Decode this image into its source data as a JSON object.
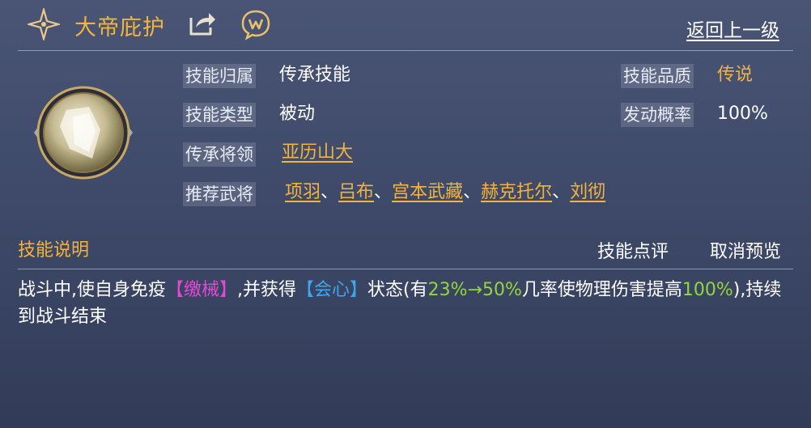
{
  "header": {
    "title": "大帝庇护",
    "back_label": "返回上一级"
  },
  "info": {
    "skill_owner_label": "技能归属",
    "skill_owner_value": "传承技能",
    "skill_type_label": "技能类型",
    "skill_type_value": "被动",
    "heritage_general_label": "传承将领",
    "heritage_general_value": "亚历山大",
    "recommend_label": "推荐武将",
    "recommended": [
      "项羽",
      "吕布",
      "宫本武藏",
      "赫克托尔",
      "刘彻"
    ],
    "separator": "、",
    "quality_label": "技能品质",
    "quality_value": "传说",
    "trigger_rate_label": "发动概率",
    "trigger_rate_value": "100%"
  },
  "description": {
    "section_title": "技能说明",
    "review_button": "技能点评",
    "cancel_preview_button": "取消预览",
    "seg1": "战斗中,使自身免疫",
    "tag1": "【缴械】",
    "seg2": ",并获得",
    "tag2": "【会心】",
    "seg3": "状态(有",
    "value1": "23%→50%",
    "seg4": "几率使物理伤害提高",
    "value2": "100%",
    "seg5": "),持续到战斗结束"
  },
  "colors": {
    "gold": "#f2b43c",
    "pink": "#e24ad6",
    "cyan": "#3ba9ee",
    "green": "#92d63f"
  },
  "icons": {
    "header": "star-compass-icon",
    "share": "share-icon",
    "chat": "chat-icon",
    "skill": "skill-emblem-icon"
  }
}
